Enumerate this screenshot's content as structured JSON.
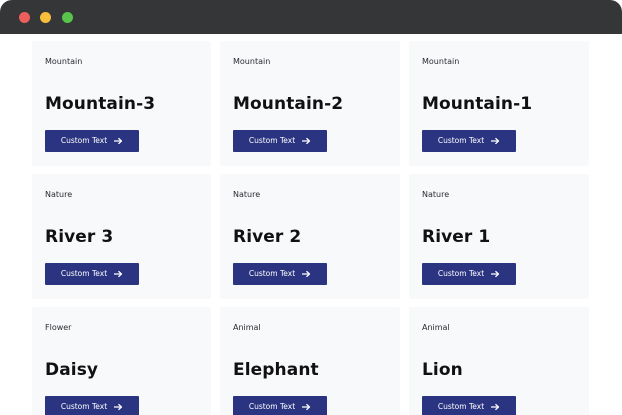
{
  "window": {
    "traffic_lights": {
      "red": "#ec5f5d",
      "yellow": "#f6be3b",
      "green": "#5ac34b"
    }
  },
  "colors": {
    "titlebar": "#343638",
    "card_background": "#f8f9fb",
    "button_background": "#2a3480",
    "button_text": "#ffffff",
    "title_text": "#111111"
  },
  "cards": [
    {
      "category": "Mountain",
      "title": "Mountain-3",
      "button_label": "Custom Text",
      "button_icon": "arrow-right-icon"
    },
    {
      "category": "Mountain",
      "title": "Mountain-2",
      "button_label": "Custom Text",
      "button_icon": "arrow-right-icon"
    },
    {
      "category": "Mountain",
      "title": "Mountain-1",
      "button_label": "Custom Text",
      "button_icon": "arrow-right-icon"
    },
    {
      "category": "Nature",
      "title": "River 3",
      "button_label": "Custom Text",
      "button_icon": "arrow-right-icon"
    },
    {
      "category": "Nature",
      "title": "River 2",
      "button_label": "Custom Text",
      "button_icon": "arrow-right-icon"
    },
    {
      "category": "Nature",
      "title": "River 1",
      "button_label": "Custom Text",
      "button_icon": "arrow-right-icon"
    },
    {
      "category": "Flower",
      "title": "Daisy",
      "button_label": "Custom Text",
      "button_icon": "arrow-right-icon"
    },
    {
      "category": "Animal",
      "title": "Elephant",
      "button_label": "Custom Text",
      "button_icon": "arrow-right-icon"
    },
    {
      "category": "Animal",
      "title": "Lion",
      "button_label": "Custom Text",
      "button_icon": "arrow-right-icon"
    }
  ]
}
